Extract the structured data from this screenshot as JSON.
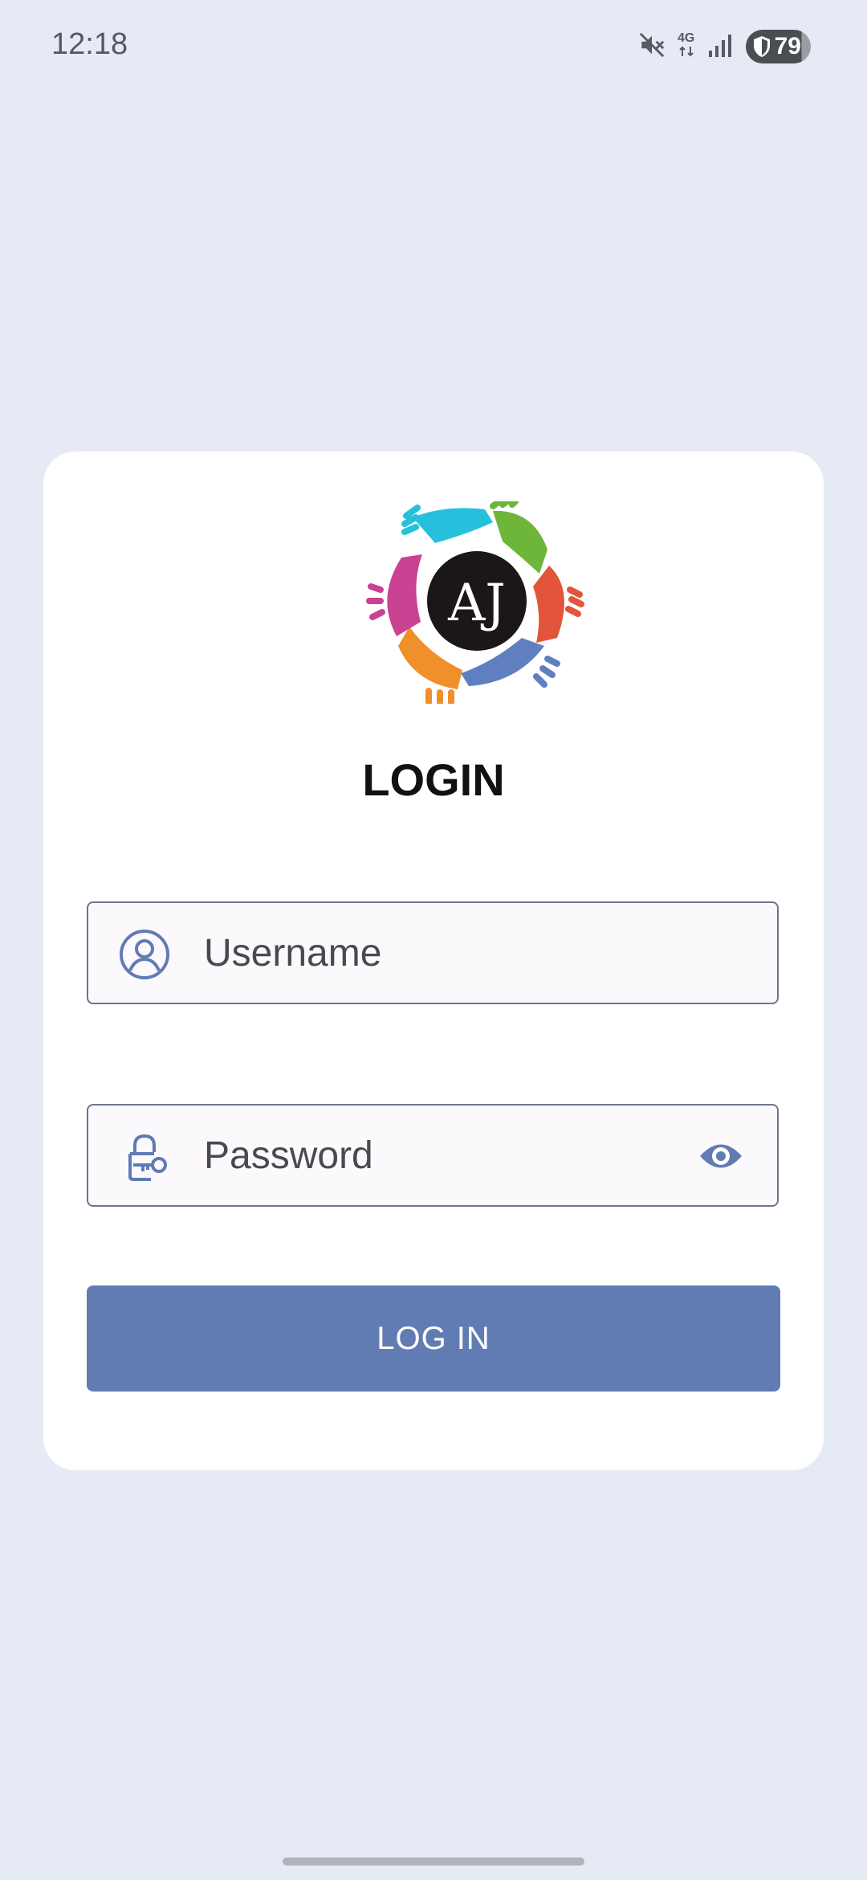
{
  "status_bar": {
    "time": "12:18",
    "network": "4G",
    "battery": "79",
    "icons": [
      "mute-icon",
      "network-4g-icon",
      "signal-icon",
      "battery-icon"
    ]
  },
  "login": {
    "logo_text": "AJ",
    "title": "LOGIN",
    "username_placeholder": "Username",
    "password_placeholder": "Password",
    "button_label": "LOG IN"
  },
  "colors": {
    "background": "#e6eaf5",
    "accent": "#617bb3",
    "field_border": "#6b7590",
    "field_background": "#fcf9fc"
  }
}
